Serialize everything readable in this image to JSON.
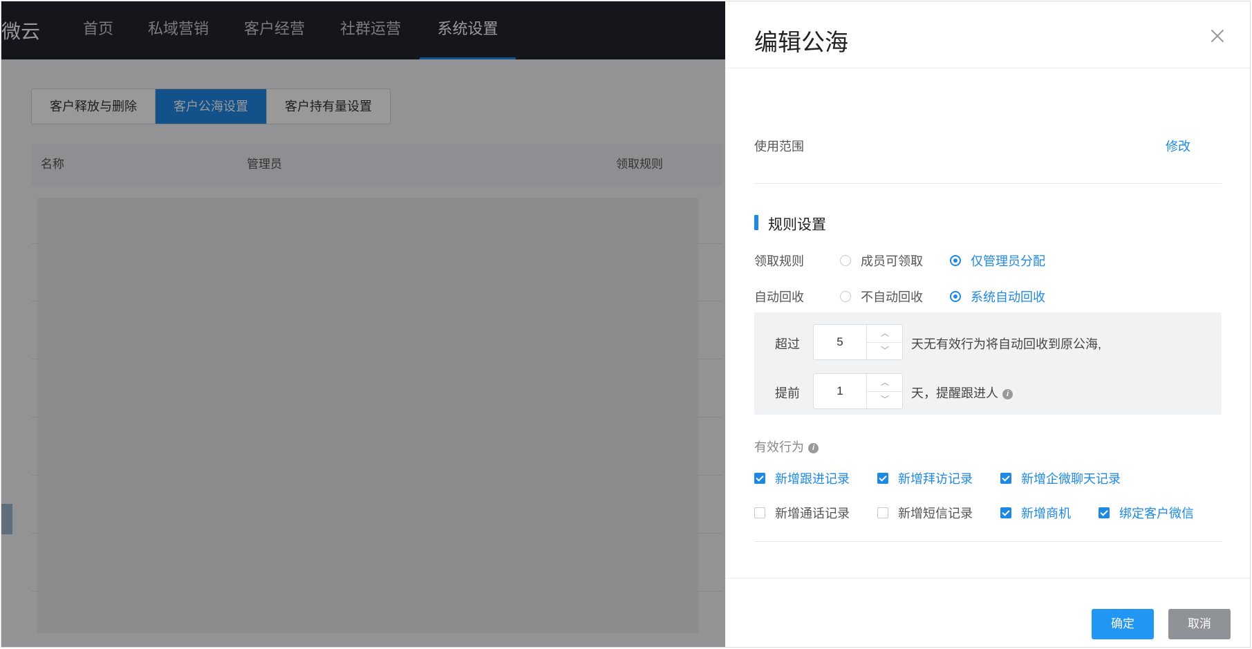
{
  "app": {
    "brand": "微云",
    "nav": [
      {
        "label": "首页"
      },
      {
        "label": "私域营销"
      },
      {
        "label": "客户经营"
      },
      {
        "label": "社群运营"
      },
      {
        "label": "系统设置",
        "active": true
      }
    ],
    "tabs": [
      {
        "label": "客户释放与删除"
      },
      {
        "label": "客户公海设置",
        "active": true
      },
      {
        "label": "客户持有量设置"
      }
    ],
    "table_headers": [
      "名称",
      "管理员",
      "领取规则"
    ]
  },
  "drawer": {
    "title": "编辑公海",
    "scope_label": "使用范围",
    "scope_edit": "修改",
    "section_title": "规则设置",
    "claim_rule": {
      "label": "领取规则",
      "options": [
        {
          "label": "成员可领取",
          "checked": false
        },
        {
          "label": "仅管理员分配",
          "checked": true
        }
      ]
    },
    "auto_recycle": {
      "label": "自动回收",
      "options": [
        {
          "label": "不自动回收",
          "checked": false
        },
        {
          "label": "系统自动回收",
          "checked": true
        }
      ]
    },
    "recycle": {
      "exceed_label": "超过",
      "exceed_value": "5",
      "exceed_suffix": "天无有效行为将自动回收到原公海,",
      "advance_label": "提前",
      "advance_value": "1",
      "advance_suffix": "天，提醒跟进人"
    },
    "effective_label": "有效行为",
    "behaviors": [
      {
        "label": "新增跟进记录",
        "checked": true
      },
      {
        "label": "新增拜访记录",
        "checked": true
      },
      {
        "label": "新增企微聊天记录",
        "checked": true
      },
      {
        "label": "新增通话记录",
        "checked": false
      },
      {
        "label": "新增短信记录",
        "checked": false
      },
      {
        "label": "新增商机",
        "checked": true
      },
      {
        "label": "绑定客户微信",
        "checked": true
      }
    ],
    "confirm": "确定",
    "cancel": "取消"
  },
  "colors": {
    "accent": "#1e88e5",
    "nav_bg": "#232630",
    "cancel_bg": "#8f9296"
  }
}
